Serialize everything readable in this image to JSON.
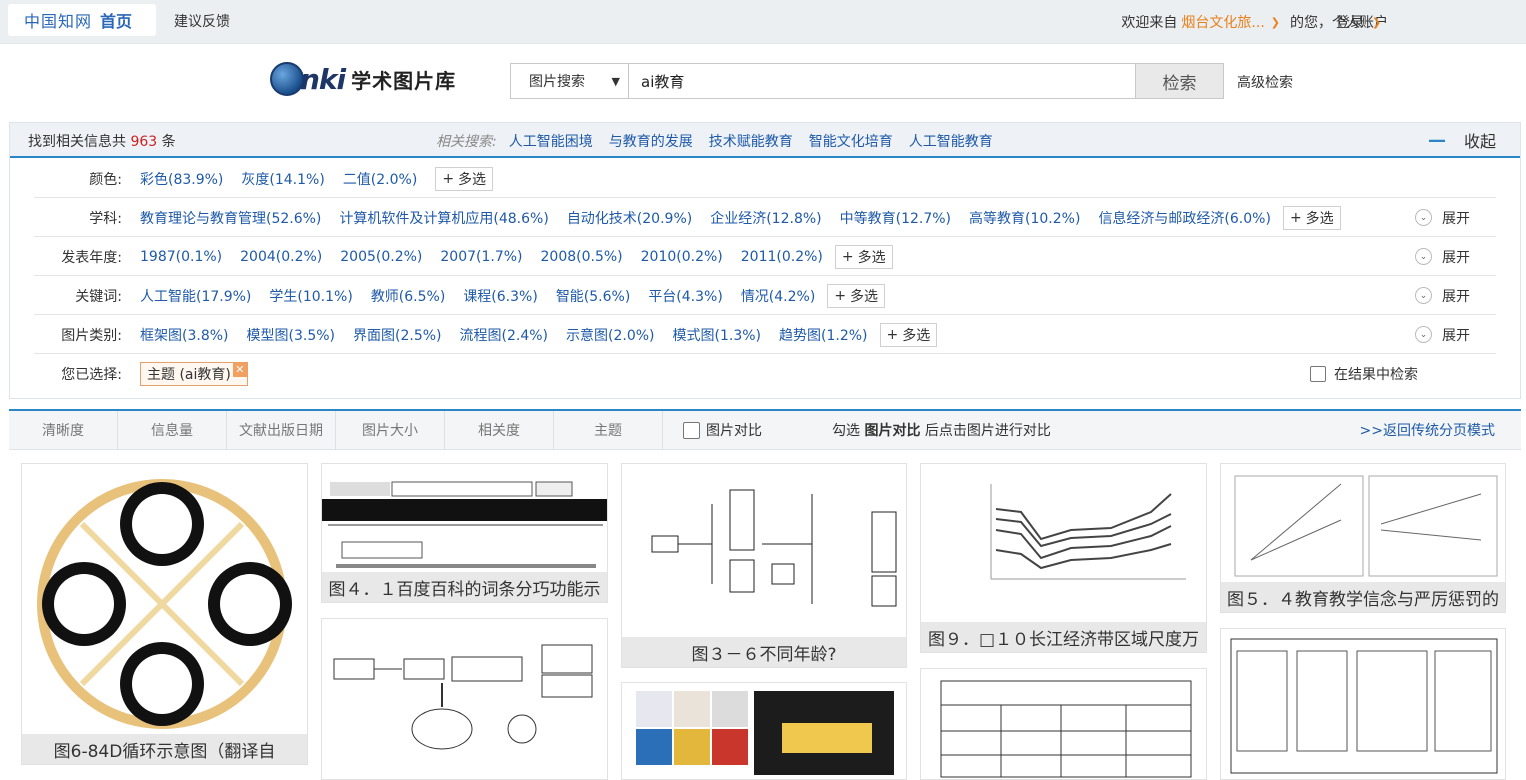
{
  "topbar": {
    "logo": "中国知网",
    "home": "首页",
    "feedback": "建议反馈",
    "welcome": "欢迎来自",
    "org": "烟台文化旅...",
    "suffix": "的您，个人账户",
    "login": "登录"
  },
  "brand": {
    "logo_text": "nki",
    "title": "学术图片库"
  },
  "search": {
    "mode": "图片搜索",
    "query": "ai教育",
    "button": "检索",
    "advanced": "高级检索"
  },
  "results": {
    "found_prefix": "找到相关信息共",
    "count": "963",
    "found_suffix": "条",
    "related_label": "相关搜索:",
    "related": [
      "人工智能困境",
      "与教育的发展",
      "技术赋能教育",
      "智能文化培育",
      "人工智能教育"
    ],
    "collapse": "收起"
  },
  "filters": {
    "color": {
      "label": "颜色:",
      "items": [
        "彩色(83.9%)",
        "灰度(14.1%)",
        "二值(2.0%)"
      ]
    },
    "subject": {
      "label": "学科:",
      "items": [
        "教育理论与教育管理(52.6%)",
        "计算机软件及计算机应用(48.6%)",
        "自动化技术(20.9%)",
        "企业经济(12.8%)",
        "中等教育(12.7%)",
        "高等教育(10.2%)",
        "信息经济与邮政经济(6.0%)"
      ]
    },
    "year": {
      "label": "发表年度:",
      "items": [
        "1987(0.1%)",
        "2004(0.2%)",
        "2005(0.2%)",
        "2007(1.7%)",
        "2008(0.5%)",
        "2010(0.2%)",
        "2011(0.2%)"
      ]
    },
    "keyword": {
      "label": "关键词:",
      "items": [
        "人工智能(17.9%)",
        "学生(10.1%)",
        "教师(6.5%)",
        "课程(6.3%)",
        "智能(5.6%)",
        "平台(4.3%)",
        "情况(4.2%)"
      ]
    },
    "type": {
      "label": "图片类别:",
      "items": [
        "框架图(3.8%)",
        "模型图(3.5%)",
        "界面图(2.5%)",
        "流程图(2.4%)",
        "示意图(2.0%)",
        "模式图(1.3%)",
        "趋势图(1.2%)"
      ]
    },
    "multi": "多选",
    "expand": "展开",
    "selected_label": "您已选择:",
    "selected_chip": "主题 (ai教育)",
    "in_results": "在结果中检索"
  },
  "sortbar": {
    "items": [
      "清晰度",
      "信息量",
      "文献出版日期",
      "图片大小",
      "相关度",
      "主题"
    ],
    "compare": "图片对比",
    "hint_pre": "勾选",
    "hint_bold": "图片对比",
    "hint_post": "后点击图片进行对比",
    "back": ">>返回传统分页模式"
  },
  "cards": [
    {
      "caption": "图6-84D循环示意图（翻译自"
    },
    {
      "caption": "图４．１百度百科的词条分巧功能示"
    },
    {
      "caption": "图３－６不同年龄?"
    },
    {
      "caption": "图９．□１０长江经济带区域尺度万"
    },
    {
      "caption": "图５．４教育教学信念与严厉惩罚的"
    }
  ]
}
